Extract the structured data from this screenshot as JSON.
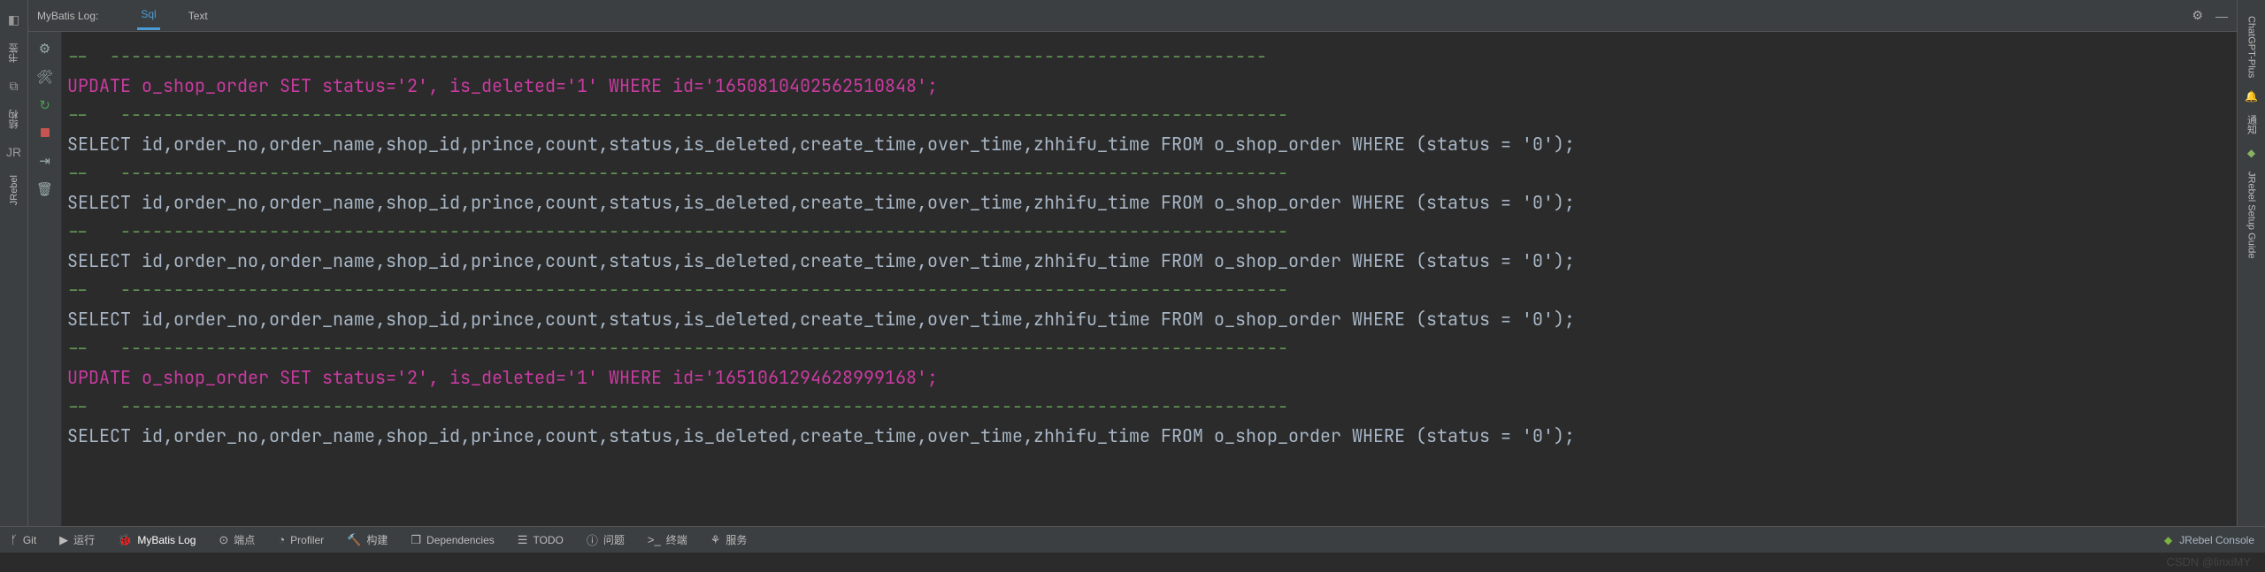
{
  "panel": {
    "title": "MyBatis Log:",
    "tabs": [
      {
        "label": "Sql",
        "active": true
      },
      {
        "label": "Text",
        "active": false
      }
    ]
  },
  "log": {
    "dash_full": "--  -------------------------------------------------------------------------------------------------------------",
    "dash_short": "--   --------------------------------------------------------------------------------------------------------------",
    "lines": [
      {
        "cls": "sep",
        "text": "--  -------------------------------------------------------------------------------------------------------------"
      },
      {
        "cls": "upd",
        "text": "UPDATE o_shop_order SET status='2', is_deleted='1' WHERE id='1650810402562510848';"
      },
      {
        "cls": "sep",
        "text": "--   --------------------------------------------------------------------------------------------------------------"
      },
      {
        "cls": "sel",
        "text": "SELECT id,order_no,order_name,shop_id,prince,count,status,is_deleted,create_time,over_time,zhhifu_time FROM o_shop_order WHERE (status = '0');"
      },
      {
        "cls": "sep",
        "text": "--   --------------------------------------------------------------------------------------------------------------"
      },
      {
        "cls": "sel",
        "text": "SELECT id,order_no,order_name,shop_id,prince,count,status,is_deleted,create_time,over_time,zhhifu_time FROM o_shop_order WHERE (status = '0');"
      },
      {
        "cls": "sep",
        "text": "--   --------------------------------------------------------------------------------------------------------------"
      },
      {
        "cls": "sel",
        "text": "SELECT id,order_no,order_name,shop_id,prince,count,status,is_deleted,create_time,over_time,zhhifu_time FROM o_shop_order WHERE (status = '0');"
      },
      {
        "cls": "sep",
        "text": "--   --------------------------------------------------------------------------------------------------------------"
      },
      {
        "cls": "sel",
        "text": "SELECT id,order_no,order_name,shop_id,prince,count,status,is_deleted,create_time,over_time,zhhifu_time FROM o_shop_order WHERE (status = '0');"
      },
      {
        "cls": "sep",
        "text": "--   --------------------------------------------------------------------------------------------------------------"
      },
      {
        "cls": "upd",
        "text": "UPDATE o_shop_order SET status='2', is_deleted='1' WHERE id='1651061294628999168';"
      },
      {
        "cls": "sep",
        "text": "--   --------------------------------------------------------------------------------------------------------------"
      },
      {
        "cls": "sel",
        "text": "SELECT id,order_no,order_name,shop_id,prince,count,status,is_deleted,create_time,over_time,zhhifu_time FROM o_shop_order WHERE (status = '0');"
      }
    ]
  },
  "left_sidebar": {
    "items": [
      {
        "label": "书签",
        "icon": "◧"
      },
      {
        "label": "结构",
        "icon": "⧉"
      },
      {
        "label": "JRebel",
        "icon": "JR"
      }
    ]
  },
  "right_sidebar": {
    "items": [
      {
        "label": "ChatGPT-Plus"
      },
      {
        "label": "通知"
      },
      {
        "label": "JRebel Setup Guide"
      }
    ]
  },
  "toolbar_col": {
    "gear": "⚙",
    "tools": "🛠",
    "rerun": "↻",
    "stop": "■",
    "step": "⇥",
    "trash": "🗑"
  },
  "statusbar": {
    "items": [
      {
        "icon": "ᚶ",
        "label": "Git"
      },
      {
        "icon": "▶",
        "label": "运行"
      },
      {
        "icon": "🐞",
        "label": "MyBatis Log",
        "active": true
      },
      {
        "icon": "⊙",
        "label": "端点"
      },
      {
        "icon": "◔",
        "label": "Profiler"
      },
      {
        "icon": "🔨",
        "label": "构建"
      },
      {
        "icon": "❒",
        "label": "Dependencies"
      },
      {
        "icon": "☰",
        "label": "TODO"
      },
      {
        "icon": "ⓘ",
        "label": "问题"
      },
      {
        "icon": ">_",
        "label": "终端"
      },
      {
        "icon": "⚘",
        "label": "服务"
      }
    ],
    "right_label": "JRebel Console"
  },
  "watermark": "CSDN @linxiMY"
}
